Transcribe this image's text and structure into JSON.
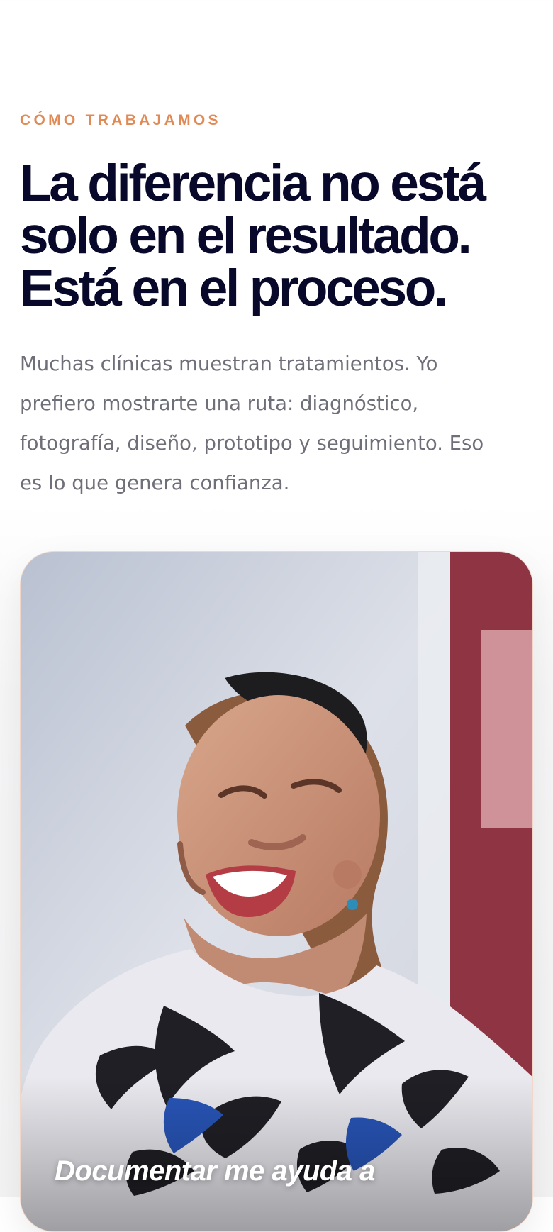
{
  "section": {
    "eyebrow": "CÓMO TRABAJAMOS",
    "headline_lines": [
      "La diferencia no está",
      "solo en el resultado.",
      "Está en el proceso."
    ],
    "lead_lines": [
      "Muchas clínicas muestran tratamientos. Yo",
      "prefiero mostrarte una ruta: diagnóstico,",
      "fotografía, diseño, prototipo y seguimiento. Eso",
      "es lo que genera confianza."
    ],
    "card": {
      "quote": "Documentar me ayuda a"
    }
  },
  "colors": {
    "eyebrow": "#e08a55",
    "headline": "#08092a",
    "lead": "#6f6f79",
    "card_border": "#f1d7c9",
    "quote_text": "#ffffff"
  },
  "icons": {
    "photo": "portrait-photo"
  }
}
